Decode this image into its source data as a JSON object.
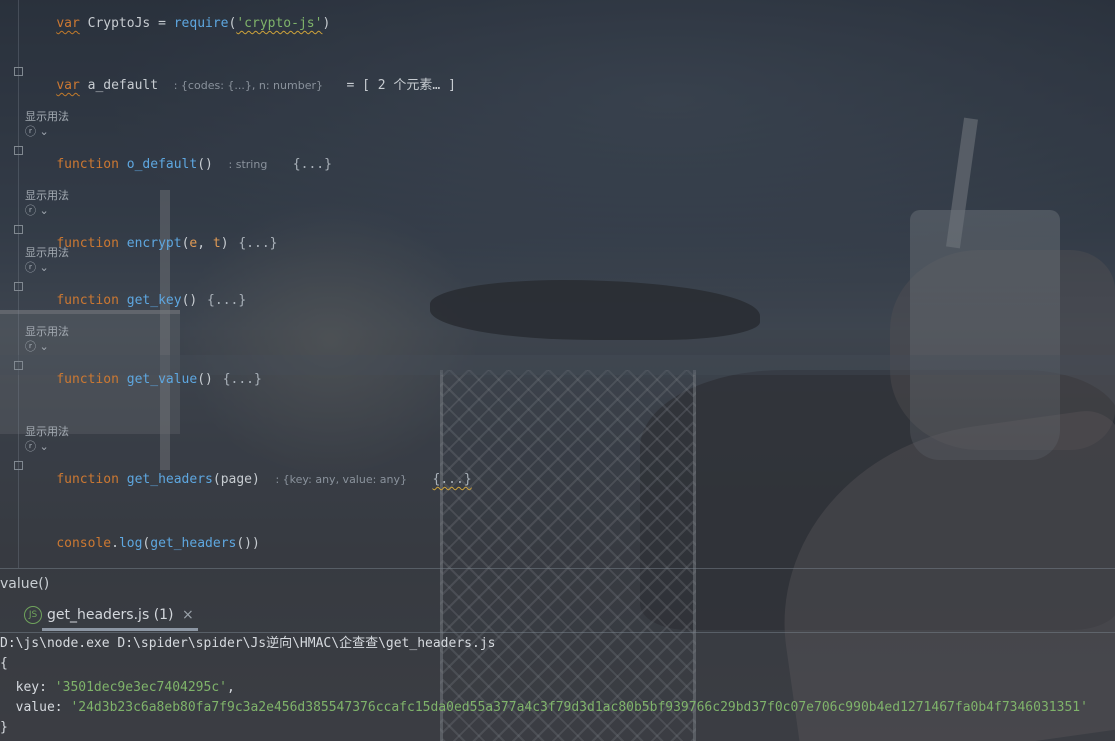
{
  "editor": {
    "line_require": {
      "kw": "var",
      "name": " CryptoJs = ",
      "fn": "require",
      "open": "(",
      "str": "'crypto-js'",
      "close": ")"
    },
    "line_a_default": {
      "kw": "var",
      "name": " a_default",
      "hint": ": {codes: {...}, n: number}",
      "eq": "= [ 2 个元素… ]"
    },
    "usage_label": "显示用法",
    "usage_icon": "ⓡ ⌄",
    "line_o_default": {
      "kw": "function",
      "fn": " o_default",
      "parens": "()",
      "hint": ": string",
      "body": "{...}"
    },
    "line_encrypt": {
      "kw": "function",
      "fn": " encrypt",
      "open": "(",
      "p1": "e",
      "sep": ", ",
      "p2": "t",
      "close": ")",
      "body": " {...}"
    },
    "line_get_key": {
      "kw": "function",
      "fn": " get_key",
      "parens": "()",
      "body": " {...}"
    },
    "line_get_value": {
      "kw": "function",
      "fn": " get_value",
      "parens": "()",
      "body": " {...}"
    },
    "line_get_headers": {
      "kw": "function",
      "fn": " get_headers",
      "open": "(",
      "p1": "page",
      "close": ")",
      "hint": ": {key: any, value: any}",
      "body": "{...}"
    },
    "line_console": {
      "obj": "console",
      "dot": ".",
      "fn": "log",
      "open": "(",
      "arg": "get_headers",
      "close": "())"
    }
  },
  "breadcrumb": "value()",
  "run_tab": {
    "icon": "JS",
    "label": "get_headers.js (1)",
    "close": "×"
  },
  "console": {
    "command": "D:\\js\\node.exe D:\\spider\\spider\\Js逆向\\HMAC\\企查查\\get_headers.js",
    "open_brace": "{",
    "key_label": "  key: ",
    "key_value": "'3501dec9e3ec7404295c'",
    "key_tail": ",",
    "value_label": "  value: ",
    "value_value": "'24d3b23c6a8eb80fa7f9c3a2e456d385547376ccafc15da0ed55a377a4c3f79d3d1ac80b5bf939766c29bd37f0c07e706c990b4ed1271467fa0b4f7346031351'",
    "close_brace": "}"
  }
}
